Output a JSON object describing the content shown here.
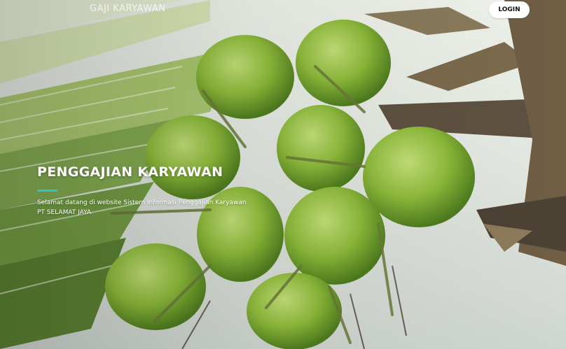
{
  "navbar": {
    "brand": "GAJI KARYAWAN",
    "login_label": "LOGIN"
  },
  "hero": {
    "title": "PENGGAJIAN KARYAWAN",
    "description_line1": "Selamat datang di website Sistem Informasi Penggajian Karyawan",
    "description_line2": "PT SELAMAT JAYA",
    "accent_color": "#2ec4c8",
    "background_image": "coconut-palm-photo"
  }
}
